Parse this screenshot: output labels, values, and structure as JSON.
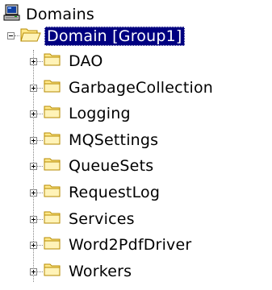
{
  "tree": {
    "root": {
      "label": "Domains",
      "icon": "computer-icon"
    },
    "domain": {
      "label": "Domain [Group1]",
      "icon": "folder-open-icon",
      "expanded": true,
      "selected": true
    },
    "children": [
      {
        "label": "DAO",
        "icon": "folder-icon",
        "expanded": false
      },
      {
        "label": "GarbageCollection",
        "icon": "folder-icon",
        "expanded": false
      },
      {
        "label": "Logging",
        "icon": "folder-icon",
        "expanded": false
      },
      {
        "label": "MQSettings",
        "icon": "folder-icon",
        "expanded": false
      },
      {
        "label": "QueueSets",
        "icon": "folder-icon",
        "expanded": false
      },
      {
        "label": "RequestLog",
        "icon": "folder-icon",
        "expanded": false
      },
      {
        "label": "Services",
        "icon": "folder-icon",
        "expanded": false
      },
      {
        "label": "Word2PdfDriver",
        "icon": "folder-icon",
        "expanded": false
      },
      {
        "label": "Workers",
        "icon": "folder-icon",
        "expanded": false
      }
    ]
  },
  "colors": {
    "selection_background": "#000080",
    "selection_text": "#ffffff",
    "folder_fill": "#ffe88a",
    "folder_outline": "#b58a00",
    "tree_lines": "#848484"
  }
}
